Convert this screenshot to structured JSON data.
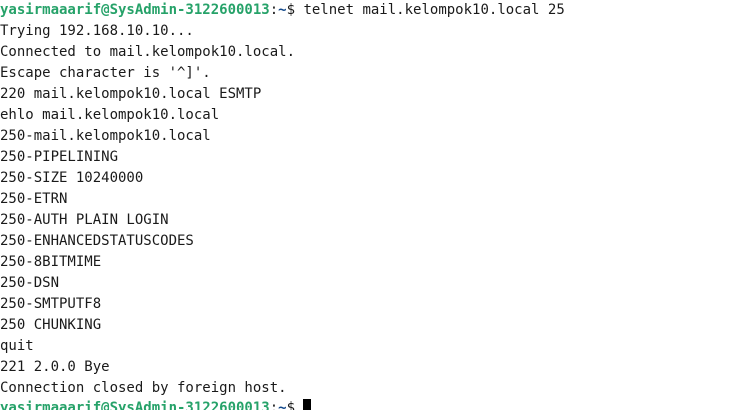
{
  "colors": {
    "background": "#ffffff",
    "text": "#1a1a1a",
    "prompt_user": "#26a269",
    "prompt_path": "#12488b",
    "cursor": "#000000"
  },
  "prompt": {
    "user_host": "yasirmaaarif@SysAdmin-3122600013",
    "sep": ":",
    "path": "~",
    "symbol": "$ "
  },
  "command": "telnet mail.kelompok10.local 25",
  "output": [
    "Trying 192.168.10.10...",
    "Connected to mail.kelompok10.local.",
    "Escape character is '^]'.",
    "220 mail.kelompok10.local ESMTP",
    "ehlo mail.kelompok10.local",
    "250-mail.kelompok10.local",
    "250-PIPELINING",
    "250-SIZE 10240000",
    "250-ETRN",
    "250-AUTH PLAIN LOGIN",
    "250-ENHANCEDSTATUSCODES",
    "250-8BITMIME",
    "250-DSN",
    "250-SMTPUTF8",
    "250 CHUNKING",
    "quit",
    "221 2.0.0 Bye",
    "Connection closed by foreign host."
  ]
}
